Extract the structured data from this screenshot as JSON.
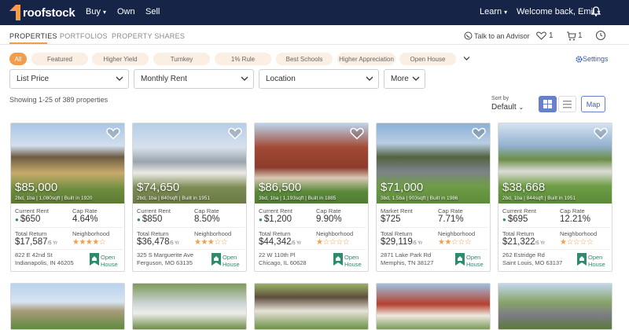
{
  "header": {
    "logo_text": "roofstock",
    "nav": [
      "Buy",
      "Own",
      "Sell"
    ],
    "learn": "Learn",
    "welcome": "Welcome back, Emil"
  },
  "tabs": [
    "PROPERTIES",
    "PORTFOLIOS",
    "PROPERTY SHARES"
  ],
  "utility": {
    "talk": "Talk to an Advisor",
    "likes": "1",
    "cart": "1"
  },
  "chips": [
    "All",
    "Featured",
    "Higher Yield",
    "Turnkey",
    "1% Rule",
    "Best Schools",
    "Higher Appreciation",
    "Open House"
  ],
  "settings": "Settings",
  "filters": [
    "List Price",
    "Monthly Rent",
    "Location",
    "More"
  ],
  "showing": "Showing 1-25 of 389 properties",
  "sort": {
    "label": "Sort by",
    "value": "Default"
  },
  "map_label": "Map",
  "colors": {
    "navy": "#152447",
    "orange": "#f39c4a",
    "blue": "#3c5da8",
    "green": "#2f8a6e",
    "grid_active": "#6a7fc9"
  },
  "cards": [
    {
      "price": "$85,000",
      "specs": "2bd, 1ba | 1,080sqft | Built in 1920",
      "rent_label": "Current Rent",
      "rent": "$650",
      "cap_label": "Cap Rate",
      "cap": "4.64%",
      "return_label": "Total Return",
      "return": "$17,587",
      "unit": "/5 Yr",
      "nb_label": "Neighborhood",
      "stars": "★★★★☆",
      "rating": 4,
      "addr1": "822 E 42nd St",
      "addr2": "Indianapolis, IN 46205",
      "oh1": "Open",
      "oh2": "House"
    },
    {
      "price": "$74,650",
      "specs": "2bd, 1ba | 840sqft | Built in 1951",
      "rent_label": "Current Rent",
      "rent": "$850",
      "cap_label": "Cap Rate",
      "cap": "8.50%",
      "return_label": "Total Return",
      "return": "$36,478",
      "unit": "/5 Yr",
      "nb_label": "Neighborhood",
      "stars": "★★★☆☆",
      "rating": 2.5,
      "addr1": "325 S Marguerite Ave",
      "addr2": "Ferguson, MO 63135",
      "oh1": "Open",
      "oh2": "House"
    },
    {
      "price": "$86,500",
      "specs": "3bd, 1ba | 1,193sqft | Built in 1885",
      "rent_label": "Current Rent",
      "rent": "$1,200",
      "cap_label": "Cap Rate",
      "cap": "9.90%",
      "return_label": "Total Return",
      "return": "$44,342",
      "unit": "/5 Yr",
      "nb_label": "Neighborhood",
      "stars": "★☆☆☆☆",
      "rating": 1,
      "addr1": "22 W 110th Pl",
      "addr2": "Chicago, IL 60628",
      "oh1": "Open",
      "oh2": "House"
    },
    {
      "price": "$71,000",
      "specs": "3bd, 1.5ba | 903sqft | Built in 1986",
      "rent_label": "Market Rent",
      "rent": "$725",
      "cap_label": "Cap Rate",
      "cap": "7.71%",
      "return_label": "Total Return",
      "return": "$29,119",
      "unit": "/5 Yr",
      "nb_label": "Neighborhood",
      "stars": "★★☆☆☆",
      "rating": 2,
      "addr1": "2871 Lake Park Rd",
      "addr2": "Memphis, TN 38127",
      "oh1": "Open",
      "oh2": "House"
    },
    {
      "price": "$38,668",
      "specs": "2bd, 1ba | 844sqft | Built in 1951",
      "rent_label": "Current Rent",
      "rent": "$695",
      "cap_label": "Cap Rate",
      "cap": "12.21%",
      "return_label": "Total Return",
      "return": "$21,322",
      "unit": "/5 Yr",
      "nb_label": "Neighborhood",
      "stars": "★☆☆☆☆",
      "rating": 1.5,
      "addr1": "262 Estridge Rd",
      "addr2": "Saint Louis, MO 63137",
      "oh1": "Open",
      "oh2": "House"
    }
  ]
}
